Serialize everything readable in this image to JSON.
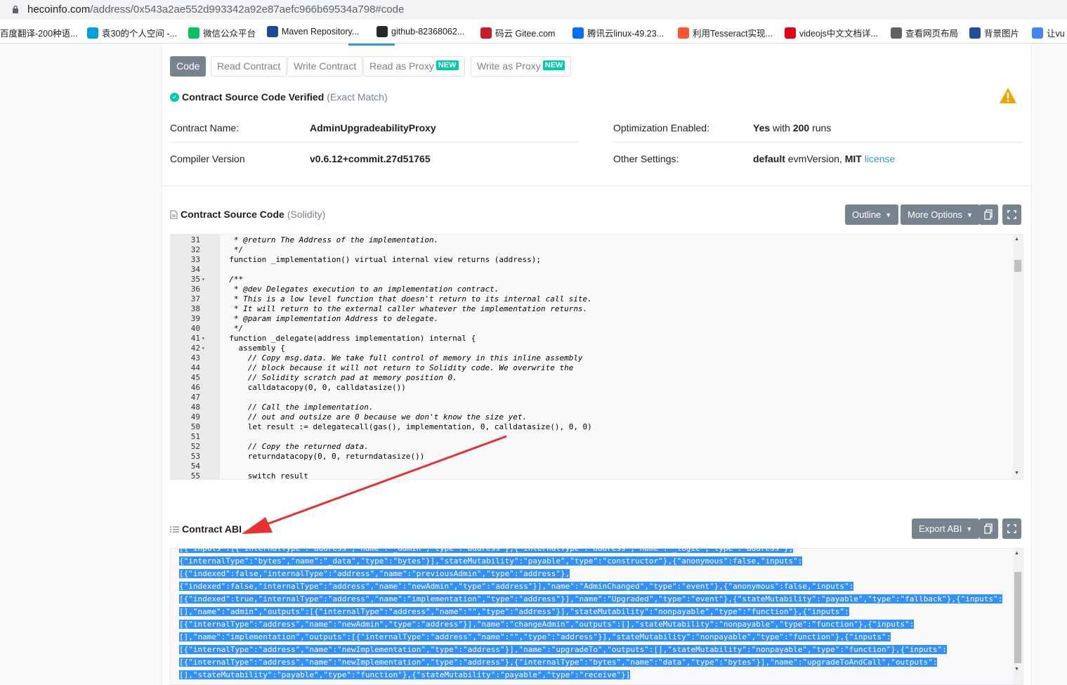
{
  "browser": {
    "url_host": "hecoinfo.com",
    "url_path": "/address/0x543a2ae552d993342a92e87aefc966b69534a798#code",
    "bookmarks": [
      {
        "label": "百度翻译-200种语...",
        "color": "#2932e1"
      },
      {
        "label": "袁30的个人空间 -...",
        "color": "#00a1d6"
      },
      {
        "label": "微信公众平台",
        "color": "#07c160"
      },
      {
        "label": "Maven Repository...",
        "color": "#1a4d8f"
      },
      {
        "label": "github-82368062...",
        "color": "#24292e"
      },
      {
        "label": "码云 Gitee.com",
        "color": "#c71d23"
      },
      {
        "label": "腾讯云linux-49.23...",
        "color": "#006eff"
      },
      {
        "label": "利用Tesseract实现...",
        "color": "#fc5531"
      },
      {
        "label": "videojs中文文档详...",
        "color": "#e60012"
      },
      {
        "label": "查看网页布局",
        "color": "#5f6368"
      },
      {
        "label": "背景图片",
        "color": "#1e4fa0"
      },
      {
        "label": "让vu",
        "color": "#4285f4"
      }
    ]
  },
  "tabs": {
    "code": "Code",
    "read_contract": "Read Contract",
    "write_contract": "Write Contract",
    "read_proxy": "Read as Proxy",
    "write_proxy": "Write as Proxy",
    "new_badge": "NEW"
  },
  "verified": {
    "title": "Contract Source Code Verified",
    "subtitle": "(Exact Match)"
  },
  "details": {
    "contract_name_label": "Contract Name:",
    "contract_name": "AdminUpgradeabilityProxy",
    "compiler_label": "Compiler Version",
    "compiler": "v0.6.12+commit.27d51765",
    "optimization_label": "Optimization Enabled:",
    "optimization_yes": "Yes",
    "optimization_with": " with ",
    "optimization_runs": "200",
    "optimization_runs_suffix": " runs",
    "other_label": "Other Settings:",
    "other_default": "default",
    "other_evm": " evmVersion, ",
    "other_mit": "MIT",
    "other_license": "license"
  },
  "source": {
    "title": "Contract Source Code",
    "subtitle": "(Solidity)",
    "outline_button": "Outline",
    "more_options_button": "More Options",
    "lines": [
      {
        "n": "31",
        "f": "",
        "t": "   * @return The Address of the implementation.",
        "c": "cm"
      },
      {
        "n": "32",
        "f": "",
        "t": "   */",
        "c": "cm"
      },
      {
        "n": "33",
        "f": "",
        "t": "  function _implementation() virtual internal view returns (address);",
        "c": ""
      },
      {
        "n": "34",
        "f": "",
        "t": "",
        "c": ""
      },
      {
        "n": "35",
        "f": "▾",
        "t": "  /**",
        "c": "cm"
      },
      {
        "n": "36",
        "f": "",
        "t": "   * @dev Delegates execution to an implementation contract.",
        "c": "cm"
      },
      {
        "n": "37",
        "f": "",
        "t": "   * This is a low level function that doesn't return to its internal call site.",
        "c": "cm"
      },
      {
        "n": "38",
        "f": "",
        "t": "   * It will return to the external caller whatever the implementation returns.",
        "c": "cm"
      },
      {
        "n": "39",
        "f": "",
        "t": "   * @param implementation Address to delegate.",
        "c": "cm"
      },
      {
        "n": "40",
        "f": "",
        "t": "   */",
        "c": "cm"
      },
      {
        "n": "41",
        "f": "▾",
        "t": "  function _delegate(address implementation) internal {",
        "c": ""
      },
      {
        "n": "42",
        "f": "▾",
        "t": "    assembly {",
        "c": ""
      },
      {
        "n": "43",
        "f": "",
        "t": "      // Copy msg.data. We take full control of memory in this inline assembly",
        "c": "cm"
      },
      {
        "n": "44",
        "f": "",
        "t": "      // block because it will not return to Solidity code. We overwrite the",
        "c": "cm"
      },
      {
        "n": "45",
        "f": "",
        "t": "      // Solidity scratch pad at memory position 0.",
        "c": "cm"
      },
      {
        "n": "46",
        "f": "",
        "t": "      calldatacopy(0, 0, calldatasize())",
        "c": ""
      },
      {
        "n": "47",
        "f": "",
        "t": "",
        "c": ""
      },
      {
        "n": "48",
        "f": "",
        "t": "      // Call the implementation.",
        "c": "cm"
      },
      {
        "n": "49",
        "f": "",
        "t": "      // out and outsize are 0 because we don't know the size yet.",
        "c": "cm"
      },
      {
        "n": "50",
        "f": "",
        "t": "      let result := delegatecall(gas(), implementation, 0, calldatasize(), 0, 0)",
        "c": ""
      },
      {
        "n": "51",
        "f": "",
        "t": "",
        "c": ""
      },
      {
        "n": "52",
        "f": "",
        "t": "      // Copy the returned data.",
        "c": "cm"
      },
      {
        "n": "53",
        "f": "",
        "t": "      returndatacopy(0, 0, returndatasize())",
        "c": ""
      },
      {
        "n": "54",
        "f": "",
        "t": "",
        "c": ""
      },
      {
        "n": "55",
        "f": "",
        "t": "      switch result",
        "c": ""
      }
    ]
  },
  "abi": {
    "title": "Contract ABI",
    "export_button": "Export ABI",
    "lines": [
      "[{\"inputs\":[{\"internalType\":\"address\",\"name\":\"_admin\",\"type\":\"address\"},{\"internalType\":\"address\",\"name\":\"_logic\",\"type\":\"address\"},",
      "{\"internalType\":\"bytes\",\"name\":\"_data\",\"type\":\"bytes\"}],\"stateMutability\":\"payable\",\"type\":\"constructor\"},{\"anonymous\":false,\"inputs\":",
      "[{\"indexed\":false,\"internalType\":\"address\",\"name\":\"previousAdmin\",\"type\":\"address\"},",
      "{\"indexed\":false,\"internalType\":\"address\",\"name\":\"newAdmin\",\"type\":\"address\"}],\"name\":\"AdminChanged\",\"type\":\"event\"},{\"anonymous\":false,\"inputs\":",
      "[{\"indexed\":true,\"internalType\":\"address\",\"name\":\"implementation\",\"type\":\"address\"}],\"name\":\"Upgraded\",\"type\":\"event\"},{\"stateMutability\":\"payable\",\"type\":\"fallback\"},{\"inputs\":",
      "[],\"name\":\"admin\",\"outputs\":[{\"internalType\":\"address\",\"name\":\"\",\"type\":\"address\"}],\"stateMutability\":\"nonpayable\",\"type\":\"function\"},{\"inputs\":",
      "[{\"internalType\":\"address\",\"name\":\"newAdmin\",\"type\":\"address\"}],\"name\":\"changeAdmin\",\"outputs\":[],\"stateMutability\":\"nonpayable\",\"type\":\"function\"},{\"inputs\":",
      "[],\"name\":\"implementation\",\"outputs\":[{\"internalType\":\"address\",\"name\":\"\",\"type\":\"address\"}],\"stateMutability\":\"nonpayable\",\"type\":\"function\"},{\"inputs\":",
      "[{\"internalType\":\"address\",\"name\":\"newImplementation\",\"type\":\"address\"}],\"name\":\"upgradeTo\",\"outputs\":[],\"stateMutability\":\"nonpayable\",\"type\":\"function\"},{\"inputs\":",
      "[{\"internalType\":\"address\",\"name\":\"newImplementation\",\"type\":\"address\"},{\"internalType\":\"bytes\",\"name\":\"data\",\"type\":\"bytes\"}],\"name\":\"upgradeToAndCall\",\"outputs\":",
      "[],\"stateMutability\":\"payable\",\"type\":\"function\"},{\"stateMutability\":\"payable\",\"type\":\"receive\"}]"
    ]
  },
  "colors": {
    "accent": "#3498db",
    "verified": "#00c9a7",
    "warning": "#f0a500",
    "annotation_arrow": "#e8312f",
    "selection": "#3390ff"
  }
}
